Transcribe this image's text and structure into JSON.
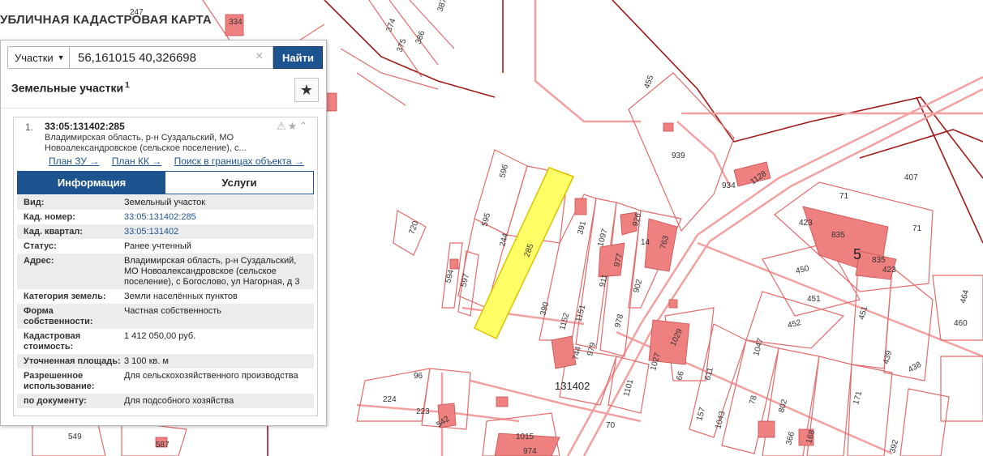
{
  "app": {
    "title": "УБЛИЧНАЯ КАДАСТРОВАЯ КАРТА"
  },
  "search": {
    "type_label": "Участки",
    "query": "56,161015 40,326698",
    "button_label": "Найти"
  },
  "panel": {
    "section_title": "Земельные участки",
    "count": "1"
  },
  "result": {
    "index": "1.",
    "cad_number": "33:05:131402:285",
    "address_short": "Владимирская область, р-н Суздальский, МО Новоалександровское (сельское поселение), с...",
    "links": [
      "План ЗУ →",
      "План КК →",
      "Поиск в границах объекта →"
    ],
    "tabs": {
      "info": "Информация",
      "services": "Услуги"
    },
    "fields": [
      {
        "k": "Вид:",
        "v": "Земельный участок"
      },
      {
        "k": "Кад. номер:",
        "v": "33:05:131402:285"
      },
      {
        "k": "Кад. квартал:",
        "v": "33:05:131402"
      },
      {
        "k": "Статус:",
        "v": "Ранее учтенный"
      },
      {
        "k": "Адрес:",
        "v": "Владимирская область, р-н Суздальский, МО Новоалександровское (сельское поселение), с Богослово, ул Нагорная, д 3"
      },
      {
        "k": "Категория земель:",
        "v": "Земли населённых пунктов"
      },
      {
        "k": "Форма собственности:",
        "v": "Частная собственность"
      },
      {
        "k": "Кадастровая стоимость:",
        "v": "1 412 050,00 руб."
      },
      {
        "k": "Уточненная площадь:",
        "v": "3 100 кв. м"
      },
      {
        "k": "Разрешенное использование:",
        "v": "Для сельскохозяйственного производства"
      },
      {
        "k": "по документу:",
        "v": "Для подсобного хозяйства"
      }
    ]
  },
  "map": {
    "colors": {
      "parcel_line": "#e36b6b",
      "building_fill": "#ee8080",
      "road": "#f2a0a0",
      "quarter_line": "#a01818",
      "selected_fill": "#ffff66"
    },
    "labels": {
      "l247": "247",
      "l334": "334",
      "l374": "374",
      "l375": "375",
      "l386": "386",
      "l387": "387",
      "l455": "455",
      "l939": "939",
      "l934": "934",
      "l1128": "1128",
      "l407": "407",
      "l423": "423",
      "l835a": "835",
      "l835b": "835",
      "l423b": "423",
      "l71a": "71",
      "l71b": "71",
      "l5": "5",
      "l596": "596",
      "l595": "595",
      "l244": "244",
      "l285": "285",
      "l720": "720",
      "l594": "594",
      "l597": "597",
      "l390": "390",
      "l391": "391",
      "l1097": "1097",
      "l926": "926",
      "l14": "14",
      "l763": "763",
      "l977": "977",
      "l911": "911",
      "l902": "902",
      "l1151": "1151",
      "l1152": "1152",
      "l978": "978",
      "l979": "979",
      "l744": "744",
      "l1027": "1027",
      "l1029": "1029",
      "l66": "66",
      "l611": "611",
      "l1047": "1047",
      "l450": "450",
      "l451a": "451",
      "l451b": "451",
      "l452": "452",
      "l439": "439",
      "l438": "438",
      "l460": "460",
      "l464": "464",
      "l131402": "131402",
      "l96": "96",
      "l224": "224",
      "l223": "223",
      "l542": "542",
      "l1015": "1015",
      "l974": "974",
      "l1101": "1101",
      "l70": "70",
      "l157": "157",
      "l1043": "1043",
      "l78": "78",
      "l802": "802",
      "l366": "366",
      "l168": "168",
      "l171": "171",
      "l392": "392",
      "l549": "549",
      "l587": "587"
    }
  }
}
